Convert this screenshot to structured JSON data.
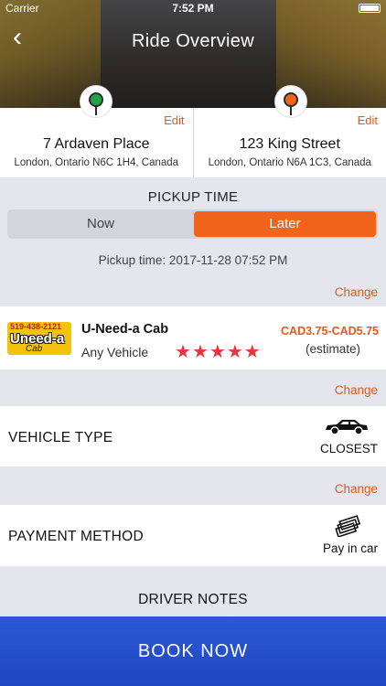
{
  "status_bar": {
    "carrier": "Carrier",
    "time": "7:52 PM"
  },
  "header": {
    "title": "Ride Overview",
    "back_icon": "chevron-left-icon"
  },
  "locations": [
    {
      "edit": "Edit",
      "address": "7 Ardaven Place",
      "city": "London, Ontario N6C 1H4, Canada",
      "pin_color": "#22a447",
      "icon": "map-pin-icon"
    },
    {
      "edit": "Edit",
      "address": "123 King Street",
      "city": "London, Ontario N6A 1C3, Canada",
      "pin_color": "#f0641c",
      "icon": "map-pin-icon"
    }
  ],
  "pickup": {
    "label": "PICKUP TIME",
    "options": [
      "Now",
      "Later"
    ],
    "selected": "Later",
    "time_text": "Pickup time: 2017-11-28 07:52 PM"
  },
  "change_label": "Change",
  "cab": {
    "logo_phone": "519-438-2121",
    "logo_brand": "Uneed-a",
    "logo_sub": "Cab",
    "name": "U-Need-a Cab",
    "vehicle": "Any Vehicle",
    "rating": 5,
    "price": "CAD3.75-CAD5.75",
    "estimate": "(estimate)"
  },
  "vehicle_type": {
    "label": "VEHICLE TYPE",
    "value": "CLOSEST",
    "icon": "car-icon"
  },
  "payment": {
    "label": "PAYMENT METHOD",
    "value": "Pay in car",
    "icon": "cash-icon"
  },
  "driver_notes": "DRIVER NOTES",
  "book_button": "BOOK NOW",
  "colors": {
    "accent": "#f0641c",
    "link": "#e15a1a",
    "primary": "#2c58d6",
    "star": "#e0383c"
  }
}
